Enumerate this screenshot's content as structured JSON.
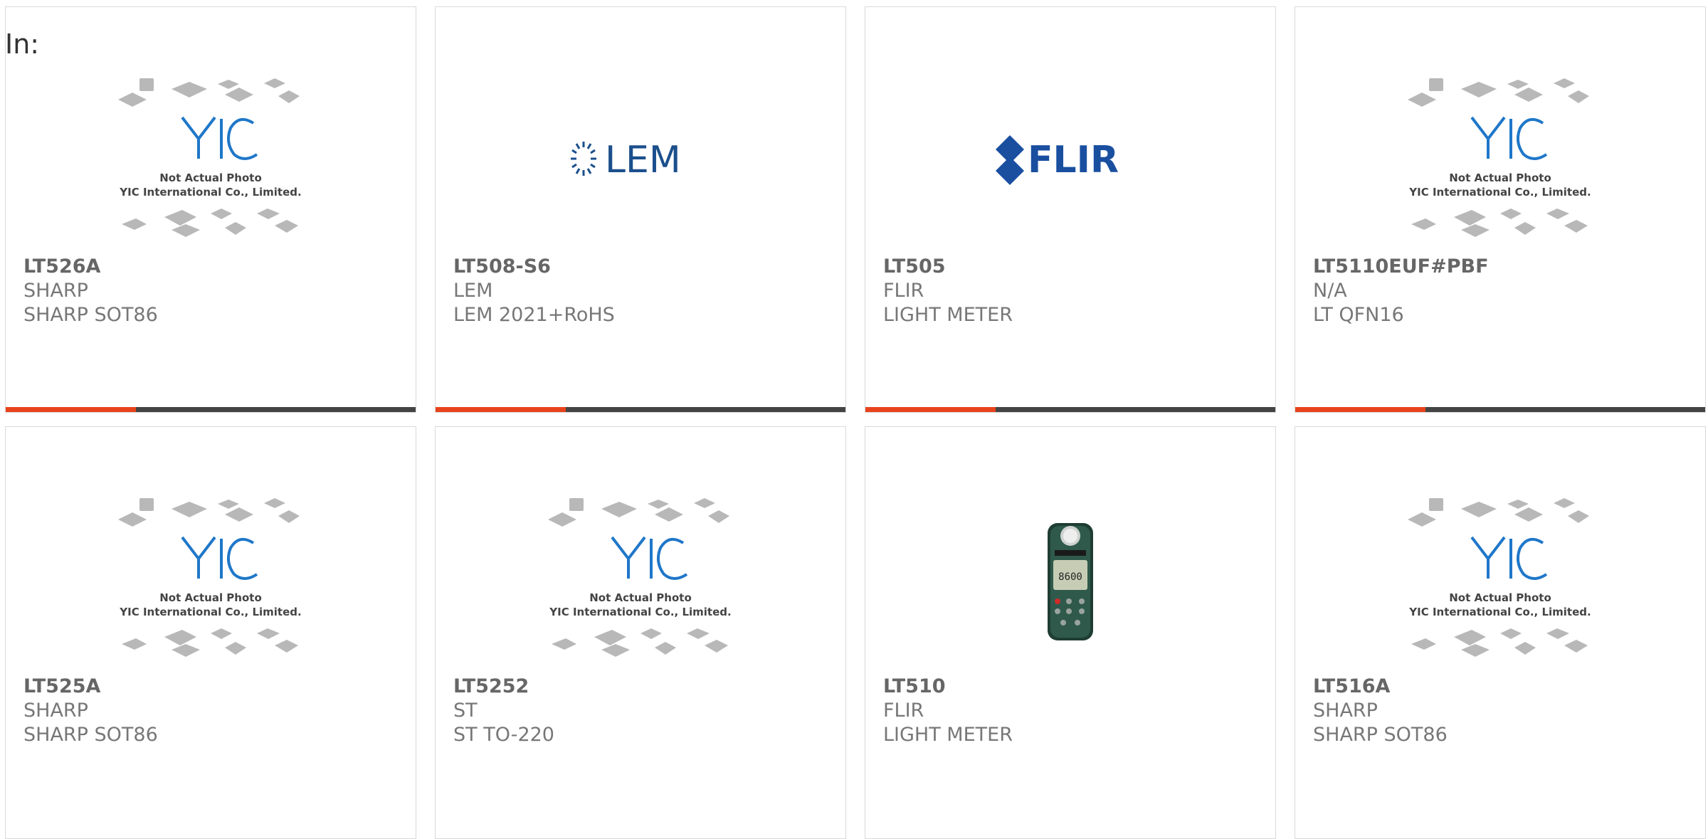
{
  "header": {
    "label": "In:"
  },
  "placeholder_image": {
    "line1": "Not Actual Photo",
    "line2": "YIC International Co., Limited.",
    "logo_text": "YIC"
  },
  "brand_logos": {
    "lem": "LEM",
    "flir": "FLIR"
  },
  "products": [
    {
      "part_number": "LT526A",
      "manufacturer": "SHARP",
      "package": "SHARP SOT86",
      "image": "yic-placeholder"
    },
    {
      "part_number": "LT508-S6",
      "manufacturer": "LEM",
      "package": "LEM 2021+RoHS",
      "image": "lem-logo"
    },
    {
      "part_number": "LT505",
      "manufacturer": "FLIR",
      "package": "LIGHT METER",
      "image": "flir-logo"
    },
    {
      "part_number": "LT5110EUF#PBF",
      "manufacturer": "N/A",
      "package": "LT QFN16",
      "image": "yic-placeholder"
    },
    {
      "part_number": "LT525A",
      "manufacturer": "SHARP",
      "package": "SHARP SOT86",
      "image": "yic-placeholder"
    },
    {
      "part_number": "LT5252",
      "manufacturer": "ST",
      "package": "ST TO-220",
      "image": "yic-placeholder"
    },
    {
      "part_number": "LT510",
      "manufacturer": "FLIR",
      "package": "LIGHT METER",
      "image": "light-meter-photo"
    },
    {
      "part_number": "LT516A",
      "manufacturer": "SHARP",
      "package": "SHARP SOT86",
      "image": "yic-placeholder"
    }
  ],
  "colors": {
    "accent": "#e8431c",
    "bar": "#444444",
    "border": "#d9d9d9",
    "lem_blue": "#1b4f8c",
    "flir_blue": "#1a4fa0",
    "yic_blue": "#1f77c9"
  }
}
